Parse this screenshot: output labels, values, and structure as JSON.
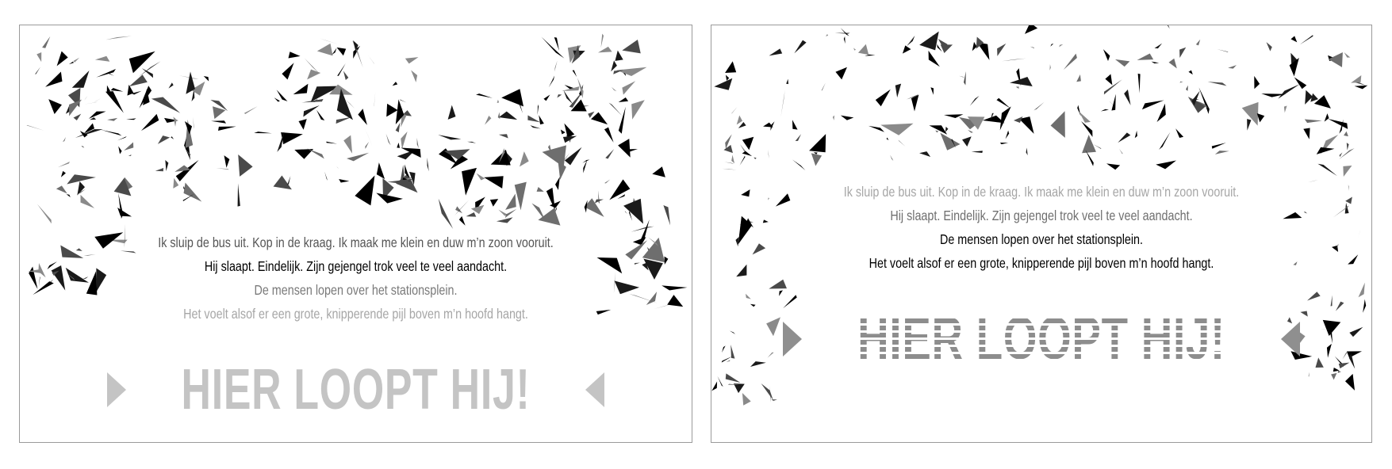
{
  "colors": {
    "black": "#000000",
    "mid_gray": "#7d7d7d",
    "light_gray": "#c4c4c4",
    "headline_right": "#8d8d8d",
    "arrow_right": "#8f8f8f"
  },
  "panels": [
    {
      "id": "left",
      "lines": [
        {
          "text": "Ik sluip de bus uit. Kop in de kraag. Ik maak me klein en duw m’n zoon vooruit.",
          "color": "#555555"
        },
        {
          "text": "Hij slaapt. Eindelijk. Zijn gejengel trok veel te veel aandacht.",
          "color": "#000000"
        },
        {
          "text": "De mensen lopen over het stationsplein.",
          "color": "#7a7a7a"
        },
        {
          "text": "Het voelt alsof er een grote, knipperende pijl boven m’n hoofd hangt.",
          "color": "#a6a6a6"
        }
      ],
      "headline": "HIER LOOPT HIJ!",
      "headline_color": "#c4c4c4",
      "arrow_color": "#c4c4c4"
    },
    {
      "id": "right",
      "lines": [
        {
          "text": "Ik sluip de bus uit. Kop in de kraag. Ik maak me klein en duw m’n zoon vooruit.",
          "color": "#a6a6a6"
        },
        {
          "text": "Hij slaapt. Eindelijk. Zijn gejengel trok veel te veel aandacht.",
          "color": "#6f6f6f"
        },
        {
          "text": "De mensen lopen over het stationsplein.",
          "color": "#000000"
        },
        {
          "text": "Het voelt alsof er een grote, knipperende pijl boven m’n hoofd hangt.",
          "color": "#000000"
        }
      ],
      "headline": "HIER LOOPT HIJ!",
      "headline_color": "#8d8d8d",
      "arrow_color": "#8f8f8f"
    }
  ]
}
